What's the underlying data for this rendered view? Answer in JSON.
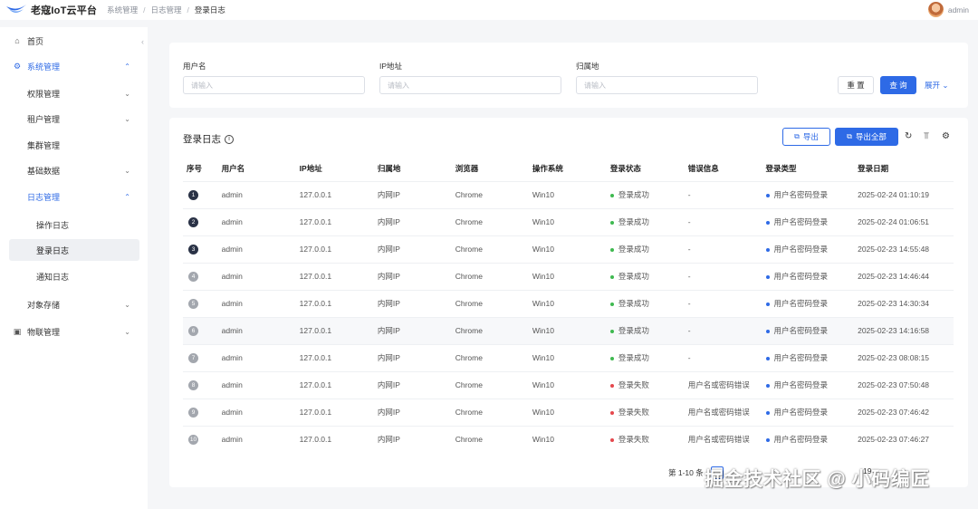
{
  "app": {
    "title": "老寇IoT云平台"
  },
  "breadcrumb": [
    "系统管理",
    "日志管理",
    "登录日志"
  ],
  "user": {
    "name": "admin"
  },
  "sidebar": {
    "collapse_glyph": "‹",
    "items": [
      {
        "label": "首页",
        "icon": "home-icon"
      },
      {
        "label": "系统管理",
        "icon": "gear-icon"
      },
      {
        "label": "权限管理"
      },
      {
        "label": "租户管理"
      },
      {
        "label": "集群管理"
      },
      {
        "label": "基础数据"
      },
      {
        "label": "日志管理"
      },
      {
        "label": "操作日志"
      },
      {
        "label": "登录日志"
      },
      {
        "label": "通知日志"
      },
      {
        "label": "对象存储"
      },
      {
        "label": "物联管理",
        "icon": "device-icon"
      }
    ]
  },
  "filters": {
    "username": {
      "label": "用户名",
      "placeholder": "请输入"
    },
    "ip": {
      "label": "IP地址",
      "placeholder": "请输入"
    },
    "location": {
      "label": "归属地",
      "placeholder": "请输入"
    },
    "reset_label": "重 置",
    "query_label": "查 询",
    "expand_label": "展开"
  },
  "table_card": {
    "title": "登录日志",
    "export_label": "导出",
    "export_all_label": "导出全部"
  },
  "table": {
    "columns": [
      "序号",
      "用户名",
      "IP地址",
      "归属地",
      "浏览器",
      "操作系统",
      "登录状态",
      "错误信息",
      "登录类型",
      "登录日期"
    ],
    "rows": [
      {
        "no": "1",
        "user": "admin",
        "ip": "127.0.0.1",
        "loc": "内网IP",
        "browser": "Chrome",
        "os": "Win10",
        "status": "登录成功",
        "error": "-",
        "type": "用户名密码登录",
        "date": "2025-02-24 01:10:19"
      },
      {
        "no": "2",
        "user": "admin",
        "ip": "127.0.0.1",
        "loc": "内网IP",
        "browser": "Chrome",
        "os": "Win10",
        "status": "登录成功",
        "error": "-",
        "type": "用户名密码登录",
        "date": "2025-02-24 01:06:51"
      },
      {
        "no": "3",
        "user": "admin",
        "ip": "127.0.0.1",
        "loc": "内网IP",
        "browser": "Chrome",
        "os": "Win10",
        "status": "登录成功",
        "error": "-",
        "type": "用户名密码登录",
        "date": "2025-02-23 14:55:48"
      },
      {
        "no": "4",
        "user": "admin",
        "ip": "127.0.0.1",
        "loc": "内网IP",
        "browser": "Chrome",
        "os": "Win10",
        "status": "登录成功",
        "error": "-",
        "type": "用户名密码登录",
        "date": "2025-02-23 14:46:44"
      },
      {
        "no": "5",
        "user": "admin",
        "ip": "127.0.0.1",
        "loc": "内网IP",
        "browser": "Chrome",
        "os": "Win10",
        "status": "登录成功",
        "error": "-",
        "type": "用户名密码登录",
        "date": "2025-02-23 14:30:34"
      },
      {
        "no": "6",
        "user": "admin",
        "ip": "127.0.0.1",
        "loc": "内网IP",
        "browser": "Chrome",
        "os": "Win10",
        "status": "登录成功",
        "error": "-",
        "type": "用户名密码登录",
        "date": "2025-02-23 14:16:58"
      },
      {
        "no": "7",
        "user": "admin",
        "ip": "127.0.0.1",
        "loc": "内网IP",
        "browser": "Chrome",
        "os": "Win10",
        "status": "登录成功",
        "error": "-",
        "type": "用户名密码登录",
        "date": "2025-02-23 08:08:15"
      },
      {
        "no": "8",
        "user": "admin",
        "ip": "127.0.0.1",
        "loc": "内网IP",
        "browser": "Chrome",
        "os": "Win10",
        "status": "登录失败",
        "error": "用户名或密码错误",
        "type": "用户名密码登录",
        "date": "2025-02-23 07:50:48"
      },
      {
        "no": "9",
        "user": "admin",
        "ip": "127.0.0.1",
        "loc": "内网IP",
        "browser": "Chrome",
        "os": "Win10",
        "status": "登录失败",
        "error": "用户名或密码错误",
        "type": "用户名密码登录",
        "date": "2025-02-23 07:46:42"
      },
      {
        "no": "10",
        "user": "admin",
        "ip": "127.0.0.1",
        "loc": "内网IP",
        "browser": "Chrome",
        "os": "Win10",
        "status": "登录失败",
        "error": "用户名或密码错误",
        "type": "用户名密码登录",
        "date": "2025-02-23 07:46:27"
      }
    ]
  },
  "pagination": {
    "summary": "第 1-10 条",
    "extra": "19"
  },
  "watermark": "掘金技术社区 @ 小码编匠",
  "colors": {
    "accent": "#2e6ae6",
    "success": "#3fb950",
    "error": "#e5484d"
  }
}
